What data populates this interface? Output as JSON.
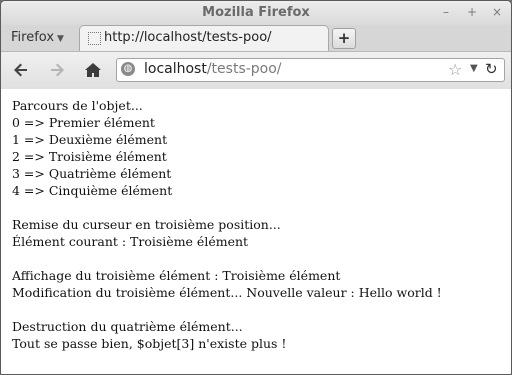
{
  "window": {
    "title": "Mozilla Firefox",
    "controls": [
      "–",
      "+",
      "×"
    ]
  },
  "tabs": {
    "menu_label": "Firefox",
    "active_tab_label": "http://localhost/tests-poo/",
    "new_tab_symbol": "+"
  },
  "navbar": {
    "url_host": "localhost",
    "url_path": "/tests-poo/"
  },
  "content": {
    "lines": [
      "Parcours de l'objet...",
      "0 => Premier élément",
      "1 => Deuxième élément",
      "2 => Troisième élément",
      "3 => Quatrième élément",
      "4 => Cinquième élément",
      "",
      "Remise du curseur en troisième position...",
      "Élément courant : Troisième élément",
      "",
      "Affichage du troisième élément : Troisième élément",
      "Modification du troisième élément... Nouvelle valeur : Hello world !",
      "",
      "Destruction du quatrième élément...",
      "Tout se passe bien, $objet[3] n'existe plus !"
    ]
  }
}
